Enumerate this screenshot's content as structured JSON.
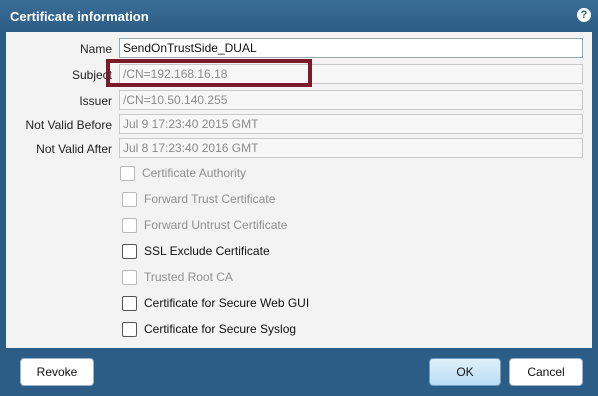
{
  "dialog": {
    "title": "Certificate information",
    "help_icon": "?"
  },
  "fields": [
    {
      "label": "Name",
      "value": "SendOnTrustSide_DUAL"
    },
    {
      "label": "Subject",
      "value": "/CN=192.168.16.18"
    },
    {
      "label": "Issuer",
      "value": "/CN=10.50.140.255"
    },
    {
      "label": "Not Valid Before",
      "value": "Jul  9 17:23:40 2015 GMT"
    },
    {
      "label": "Not Valid After",
      "value": "Jul  8 17:23:40 2016 GMT"
    }
  ],
  "checkboxes": [
    {
      "label": "Certificate Authority",
      "checked": false,
      "enabled": false
    },
    {
      "label": "Forward Trust Certificate",
      "checked": false,
      "enabled": false
    },
    {
      "label": "Forward Untrust Certificate",
      "checked": false,
      "enabled": false
    },
    {
      "label": "SSL Exclude Certificate",
      "checked": false,
      "enabled": true
    },
    {
      "label": "Trusted Root CA",
      "checked": false,
      "enabled": false
    },
    {
      "label": "Certificate for Secure Web GUI",
      "checked": false,
      "enabled": true
    },
    {
      "label": "Certificate for Secure Syslog",
      "checked": false,
      "enabled": true
    }
  ],
  "buttons": {
    "revoke": "Revoke",
    "ok": "OK",
    "cancel": "Cancel"
  },
  "colors": {
    "accent": "#2c5d87",
    "highlight": "#7a1a2a"
  }
}
